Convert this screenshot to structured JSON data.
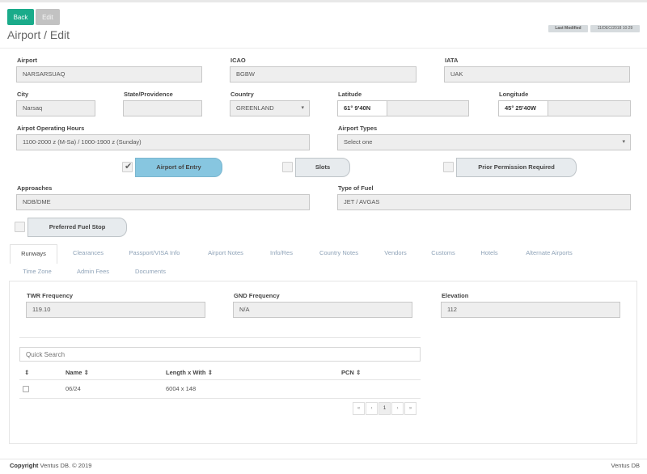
{
  "header": {
    "back_label": "Back",
    "edit_label": "Edit",
    "title": "Airport / Edit",
    "last_modified_label": "Last Modified",
    "last_modified_value": "11/DEC/2018 10:29"
  },
  "form": {
    "airport": {
      "label": "Airport",
      "value": "NARSARSUAQ"
    },
    "icao": {
      "label": "ICAO",
      "value": "BGBW"
    },
    "iata": {
      "label": "IATA",
      "value": "UAK"
    },
    "city": {
      "label": "City",
      "value": "Narsaq"
    },
    "state": {
      "label": "State/Providence",
      "value": ""
    },
    "country": {
      "label": "Country",
      "value": "GREENLAND"
    },
    "latitude": {
      "label": "Latitude",
      "value": "61° 9'40N",
      "value2": ""
    },
    "longitude": {
      "label": "Longitude",
      "value": "45° 25'40W",
      "value2": ""
    },
    "operating_hours": {
      "label": "Airpot Operating Hours",
      "value": "1100-2000 z (M-Sa) / 1000-1900 z (Sunday)"
    },
    "airport_types": {
      "label": "Airport Types",
      "value": "Select one"
    },
    "approaches": {
      "label": "Approaches",
      "value": "NDB/DME"
    },
    "fuel_type": {
      "label": "Type of Fuel",
      "value": "JET / AVGAS"
    }
  },
  "toggles": {
    "entry": {
      "label": "Airport of Entry",
      "checked": true
    },
    "slots": {
      "label": "Slots",
      "checked": false
    },
    "ppr": {
      "label": "Prior Permission Required",
      "checked": false
    },
    "fuel_stop": {
      "label": "Preferred Fuel Stop",
      "checked": false
    }
  },
  "tabs": [
    "Runways",
    "Clearances",
    "Passport/VISA Info",
    "Airport Notes",
    "Info/Res",
    "Country Notes",
    "Vendors",
    "Customs",
    "Hotels",
    "Alternate Airports",
    "Time Zone",
    "Admin Fees",
    "Documents"
  ],
  "runways": {
    "twr": {
      "label": "TWR Frequency",
      "value": "119.10"
    },
    "gnd": {
      "label": "GND Frequency",
      "value": "N/A"
    },
    "elevation": {
      "label": "Elevation",
      "value": "112"
    },
    "search_placeholder": "Quick Search",
    "columns": [
      "Name",
      "Length x With",
      "PCN"
    ],
    "sort_glyph": "⇕",
    "rows": [
      {
        "name": "06/24",
        "length": "6004 x 148",
        "pcn": ""
      }
    ],
    "pager": [
      "«",
      "‹",
      "1",
      "›",
      "»"
    ]
  },
  "footer": {
    "copyright_label": "Copyright",
    "copyright_text": "Ventus DB. © 2019",
    "right": "Ventus DB"
  },
  "colors": {
    "accent": "#1aab8a",
    "active_toggle": "#87c6e0"
  }
}
